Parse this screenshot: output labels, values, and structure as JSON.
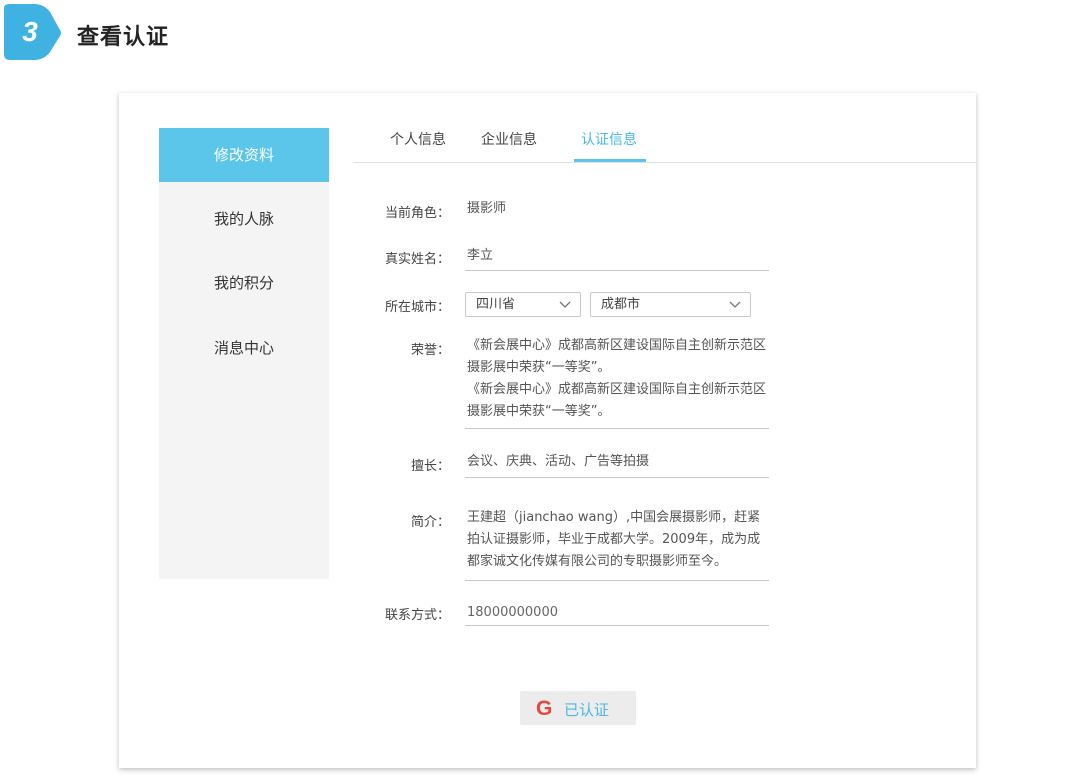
{
  "step": {
    "number": "3",
    "title": "查看认证",
    "badge_color": "#3fb2e2"
  },
  "sidebar": {
    "items": [
      {
        "label": "修改资料",
        "active": true
      },
      {
        "label": "我的人脉",
        "active": false
      },
      {
        "label": "我的积分",
        "active": false
      },
      {
        "label": "消息中心",
        "active": false
      }
    ]
  },
  "tabs": [
    {
      "label": "个人信息",
      "active": false
    },
    {
      "label": "企业信息",
      "active": false
    },
    {
      "label": "认证信息",
      "active": true
    }
  ],
  "form": {
    "role": {
      "label": "当前角色：",
      "value": "摄影师"
    },
    "name": {
      "label": "真实姓名：",
      "value": "李立"
    },
    "city": {
      "label": "所在城市：",
      "province": "四川省",
      "city": "成都市"
    },
    "honors": {
      "label": "荣誉：",
      "lines": [
        "《新会展中心》成都高新区建设国际自主创新示范区",
        "摄影展中荣获“一等奖”。",
        "《新会展中心》成都高新区建设国际自主创新示范区",
        "摄影展中荣获“一等奖”。"
      ]
    },
    "specialty": {
      "label": "擅长：",
      "value": "会议、庆典、活动、广告等拍摄"
    },
    "intro": {
      "label": "简介：",
      "lines": [
        "王建超（jianchao wang）,中国会展摄影师，赶紧",
        "拍认证摄影师，毕业于成都大学。2009年，成为成",
        "都家诚文化传媒有限公司的专职摄影师至今。"
      ]
    },
    "contact": {
      "label": "联系方式：",
      "value": "18000000000"
    }
  },
  "verify_button": {
    "icon": "G",
    "label": "已认证"
  },
  "colors": {
    "accent": "#5bc5ea",
    "tab_active": "#49b8e4",
    "sidebar_bg": "#f4f4f4"
  }
}
